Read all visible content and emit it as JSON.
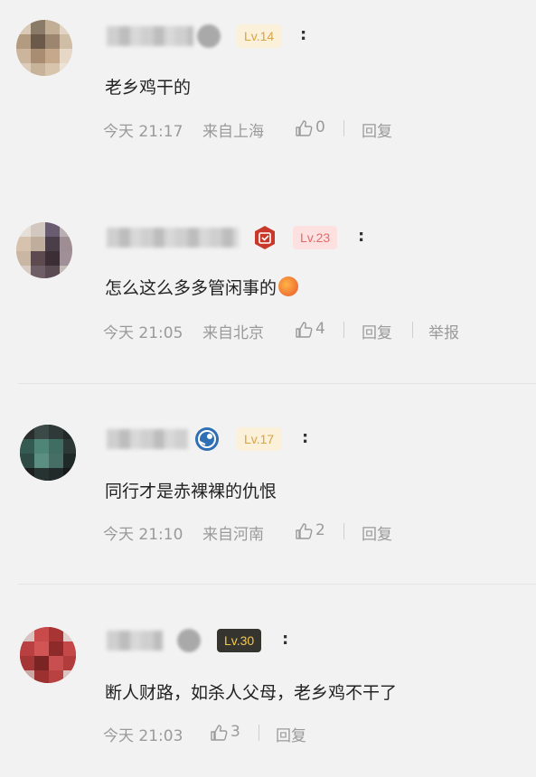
{
  "comments": [
    {
      "level": "Lv.14",
      "level_style": "gold",
      "text": "老乡鸡干的",
      "time": "今天 21:17",
      "location": "来自上海",
      "likes": "0",
      "reply": "回复",
      "report": null
    },
    {
      "level": "Lv.23",
      "level_style": "red",
      "text": "怎么这么多多管闲事的",
      "time": "今天 21:05",
      "location": "来自北京",
      "likes": "4",
      "reply": "回复",
      "report": "举报"
    },
    {
      "level": "Lv.17",
      "level_style": "gold",
      "text": "同行才是赤裸裸的仇恨",
      "time": "今天 21:10",
      "location": "来自河南",
      "likes": "2",
      "reply": "回复",
      "report": null
    },
    {
      "level": "Lv.30",
      "level_style": "dark",
      "text": "断人财路，如杀人父母，老乡鸡不干了",
      "time": "今天 21:03",
      "location": null,
      "likes": "3",
      "reply": "回复",
      "report": null
    }
  ],
  "more_symbol": ":",
  "colors": {
    "background": "#f2f2f2",
    "meta_text": "#9a9a9a",
    "level_gold": "#d7a447",
    "level_red": "#e26a6a",
    "level_dark_bg": "#36342f"
  }
}
